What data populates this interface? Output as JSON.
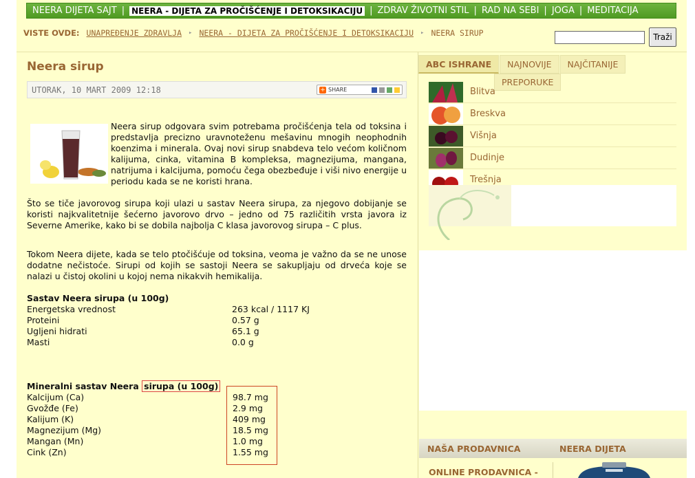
{
  "nav": {
    "items": [
      {
        "label": "NEERA DIJETA SAJT",
        "active": false
      },
      {
        "label": "NEERA - DIJETA ZA PROČIŠĆENJE I DETOKSIKACIJU",
        "active": true
      },
      {
        "label": "ZDRAV ŽIVOTNI STIL",
        "active": false
      },
      {
        "label": "RAD NA SEBI",
        "active": false
      },
      {
        "label": "JOGA",
        "active": false
      },
      {
        "label": "MEDITACIJA",
        "active": false
      }
    ]
  },
  "breadcrumb": {
    "label": "VISTE OVDE:",
    "links": [
      "UNAPREĐENJE ZDRAVLJA",
      "NEERA - DIJETA ZA PROČIŠĆENJE I DETOKSIKACIJU"
    ],
    "current": "NEERA SIRUP"
  },
  "search": {
    "value": "",
    "button": "Traži"
  },
  "article": {
    "title": "Neera sirup",
    "date": "UTORAK, 10 MART 2009 12:18",
    "share": "SHARE",
    "p1": "Neera sirup odgovara svim potrebama pročišćenja tela od toksina i predstavlja precizno uravnoteženu mešavinu mnogih neophodnih koenzima i minerala. Ovaj novi sirup snabdeva telo većom količnom kalijuma, cinka, vitamina B kompleksa, magnezijuma, mangana, natrijuma i kalcijuma, pomoću čega obezbeđuje i viši nivo energije u periodu kada se ne koristi hrana.",
    "p2": "Što se tiče javorovog sirupa koji ulazi u sastav Neera sirupa, za njegovo dobijanje se koristi najkvalitetnije šećerno javorovo drvo – jedno od 75 različitih vrsta javora iz Severne Amerike, kako bi se dobila najbolja C klasa javorovog sirupa – C plus.",
    "p3": "Tokom Neera dijete, kada se telo ptočišćuje od toksina, veoma je važno da se ne unose dodatne nečistoće. Sirupi od kojih se sastoji Neera se sakupljaju od drveća koje se nalazi u čistoj okolini u kojoj nema nikakvih hemikalija.",
    "composition": {
      "title": "Sastav Neera sirupa (u 100g)",
      "rows": [
        {
          "name": "Energetska vrednost",
          "value": "263 kcal / 1117 KJ"
        },
        {
          "name": "Proteini",
          "value": "0.57 g"
        },
        {
          "name": "Ugljeni hidrati",
          "value": "65.1 g"
        },
        {
          "name": "Masti",
          "value": "0.0 g"
        }
      ]
    },
    "minerals": {
      "title_a": "Mineralni sastav Neera",
      "title_b": "sirupa (u 100g)",
      "rows": [
        {
          "name": "Kalcijum (Ca)",
          "value": "98.7 mg"
        },
        {
          "name": "Gvožđe (Fe)",
          "value": "2.9 mg"
        },
        {
          "name": "Kalijum (K)",
          "value": "409 mg"
        },
        {
          "name": "Magnezijum (Mg)",
          "value": "18.5 mg"
        },
        {
          "name": "Mangan (Mn)",
          "value": "1.0 mg"
        },
        {
          "name": "Cink (Zn)",
          "value": "1.55 mg"
        }
      ]
    }
  },
  "sidebar": {
    "tabs": [
      "ABC ISHRANE",
      "NAJNOVIJE",
      "NAJČITANIJE"
    ],
    "tab_row2": "PREPORUKE",
    "abc": [
      "Blitva",
      "Breskva",
      "Višnja",
      "Dudinje",
      "Trešnja"
    ],
    "shop_title": "NAŠA PRODAVNICA",
    "diet_title": "NEERA DIJETA",
    "shop_text": "ONLINE PRODAVNICA -"
  }
}
